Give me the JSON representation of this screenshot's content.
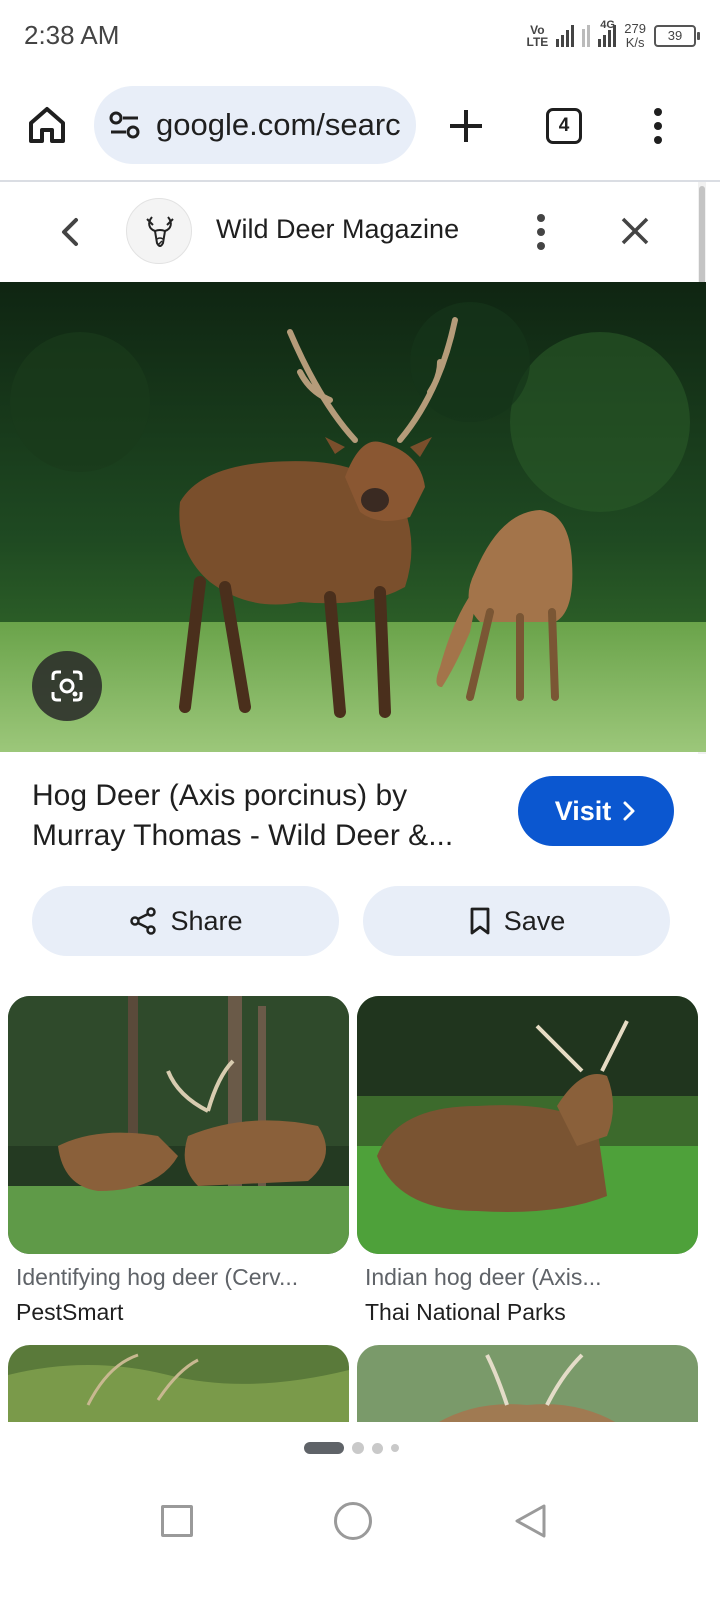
{
  "status_bar": {
    "time": "2:38 AM",
    "volte_top": "Vo",
    "volte_bottom": "LTE",
    "net_type": "4G",
    "speed_value": "279",
    "speed_unit": "K/s",
    "battery": "39"
  },
  "browser": {
    "url": "google.com/search",
    "tab_count": "4"
  },
  "viewer": {
    "site_name": "Wild Deer Magazine",
    "title_line1": "Hog Deer (Axis porcinus) by",
    "title_line2": "Murray Thomas - Wild Deer &...",
    "visit_label": "Visit",
    "share_label": "Share",
    "save_label": "Save"
  },
  "related": [
    {
      "caption": "Identifying hog deer (Cerv...",
      "source": "PestSmart"
    },
    {
      "caption": "Indian hog deer (Axis...",
      "source": "Thai National Parks"
    }
  ],
  "pager": {
    "active_index": 0,
    "count": 4
  },
  "colors": {
    "accent": "#0b57d0",
    "pill_bg": "#e8eef8",
    "omnibox_bg": "#e8eef8"
  }
}
